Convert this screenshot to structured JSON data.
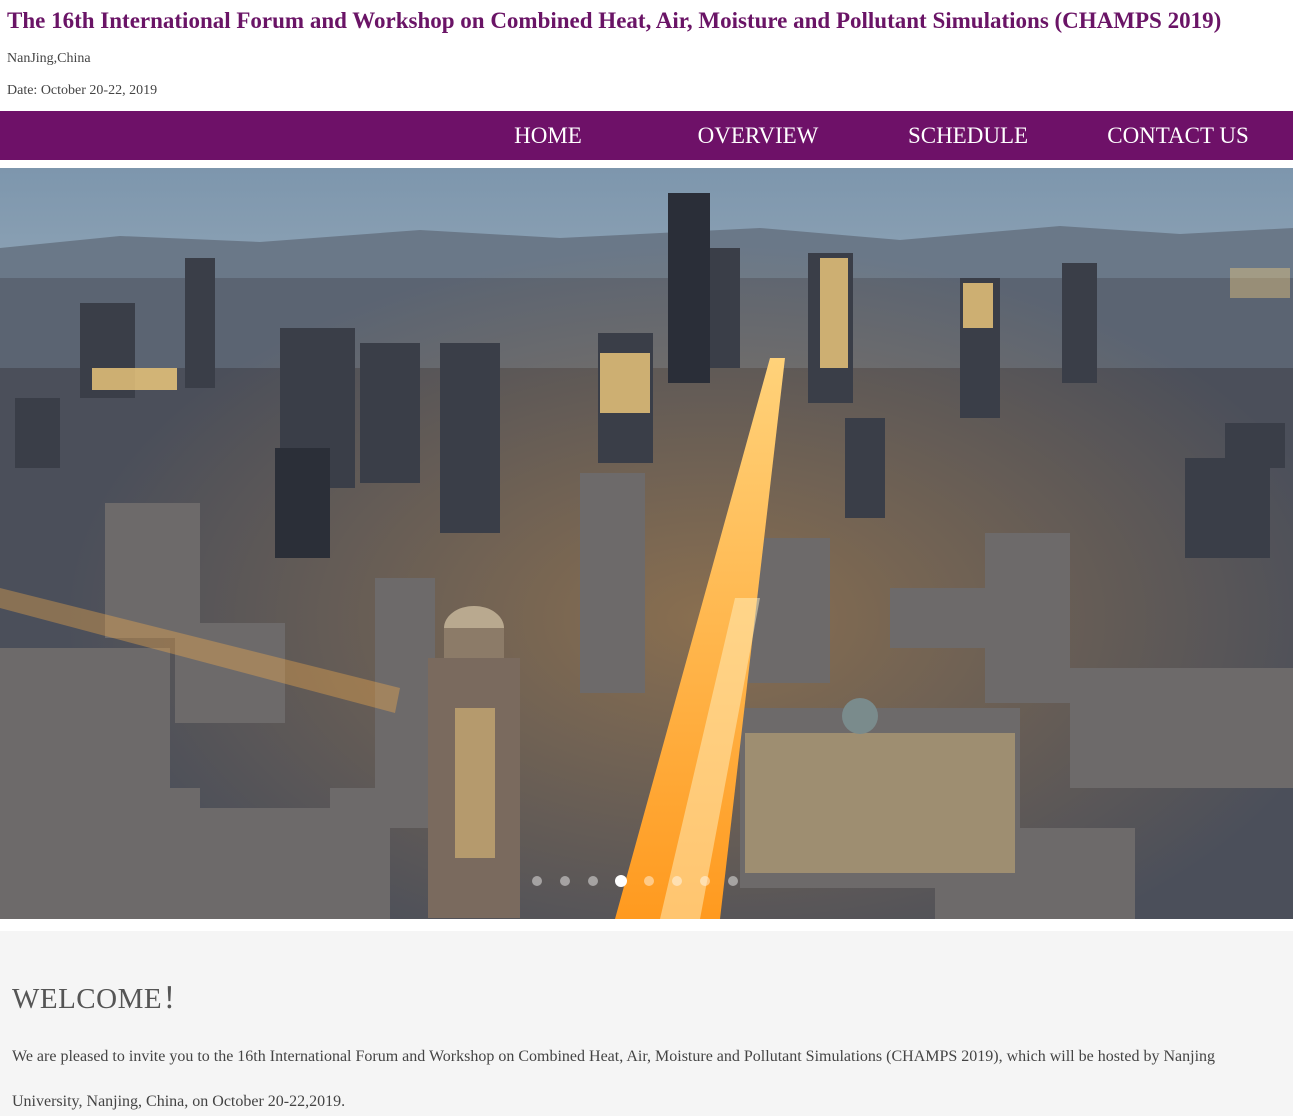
{
  "header": {
    "title": "The 16th International Forum and Workshop on Combined Heat, Air, Moisture and Pollutant Simulations (CHAMPS 2019)",
    "location": "NanJing,China",
    "date": "Date: October 20-22, 2019"
  },
  "nav": {
    "items": [
      {
        "label": "HOME"
      },
      {
        "label": "OVERVIEW"
      },
      {
        "label": "SCHEDULE"
      },
      {
        "label": "CONTACT US"
      }
    ]
  },
  "carousel": {
    "slide_count": 8,
    "active_slide": 4
  },
  "welcome": {
    "title": "WELCOME！",
    "text": "We are pleased to invite you to the 16th International Forum and Workshop on Combined Heat, Air, Moisture and Pollutant Simulations (CHAMPS 2019), which will be hosted by Nanjing University, Nanjing, China, on October 20-22,2019."
  },
  "colors": {
    "brand": "#6e1168",
    "title": "#6a1466",
    "welcome_bg": "#f5f5f5"
  }
}
